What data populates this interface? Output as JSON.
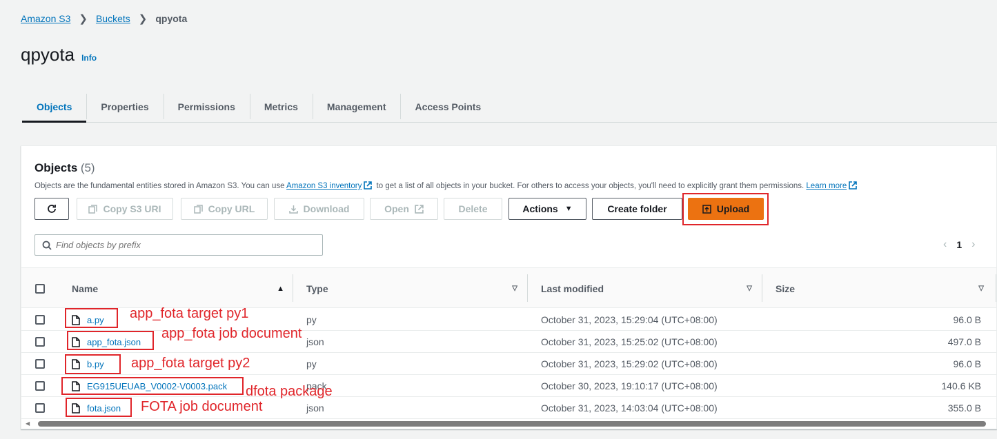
{
  "breadcrumb": {
    "items": [
      "Amazon S3",
      "Buckets"
    ],
    "current": "qpyota"
  },
  "page": {
    "title": "qpyota",
    "info": "Info"
  },
  "tabs": [
    "Objects",
    "Properties",
    "Permissions",
    "Metrics",
    "Management",
    "Access Points"
  ],
  "objects": {
    "title": "Objects",
    "count": "(5)",
    "desc_pre": "Objects are the fundamental entities stored in Amazon S3. You can use ",
    "desc_link1": "Amazon S3 inventory",
    "desc_mid": " to get a list of all objects in your bucket. For others to access your objects, you'll need to explicitly grant them permissions. ",
    "desc_link2": "Learn more"
  },
  "toolbar": {
    "copy_s3_uri": "Copy S3 URI",
    "copy_url": "Copy URL",
    "download": "Download",
    "open": "Open",
    "delete": "Delete",
    "actions": "Actions",
    "create_folder": "Create folder",
    "upload": "Upload"
  },
  "search": {
    "placeholder": "Find objects by prefix"
  },
  "pagination": {
    "page": "1"
  },
  "columns": [
    "Name",
    "Type",
    "Last modified",
    "Size"
  ],
  "rows": [
    {
      "name": "a.py",
      "type": "py",
      "modified": "October 31, 2023, 15:29:04 (UTC+08:00)",
      "size": "96.0 B"
    },
    {
      "name": "app_fota.json",
      "type": "json",
      "modified": "October 31, 2023, 15:25:02 (UTC+08:00)",
      "size": "497.0 B"
    },
    {
      "name": "b.py",
      "type": "py",
      "modified": "October 31, 2023, 15:29:02 (UTC+08:00)",
      "size": "96.0 B"
    },
    {
      "name": "EG915UEUAB_V0002-V0003.pack",
      "type": "pack",
      "modified": "October 30, 2023, 19:10:17 (UTC+08:00)",
      "size": "140.6 KB"
    },
    {
      "name": "fota.json",
      "type": "json",
      "modified": "October 31, 2023, 14:03:04 (UTC+08:00)",
      "size": "355.0 B"
    }
  ],
  "annotations": {
    "a": "app_fota target py1",
    "app_fota": "app_fota job document",
    "b": "app_fota target py2",
    "pack": "dfota package",
    "fota": "FOTA job document"
  },
  "colors": {
    "accent": "#0073bb",
    "primary": "#ec7211",
    "annotation": "#e0252a"
  }
}
